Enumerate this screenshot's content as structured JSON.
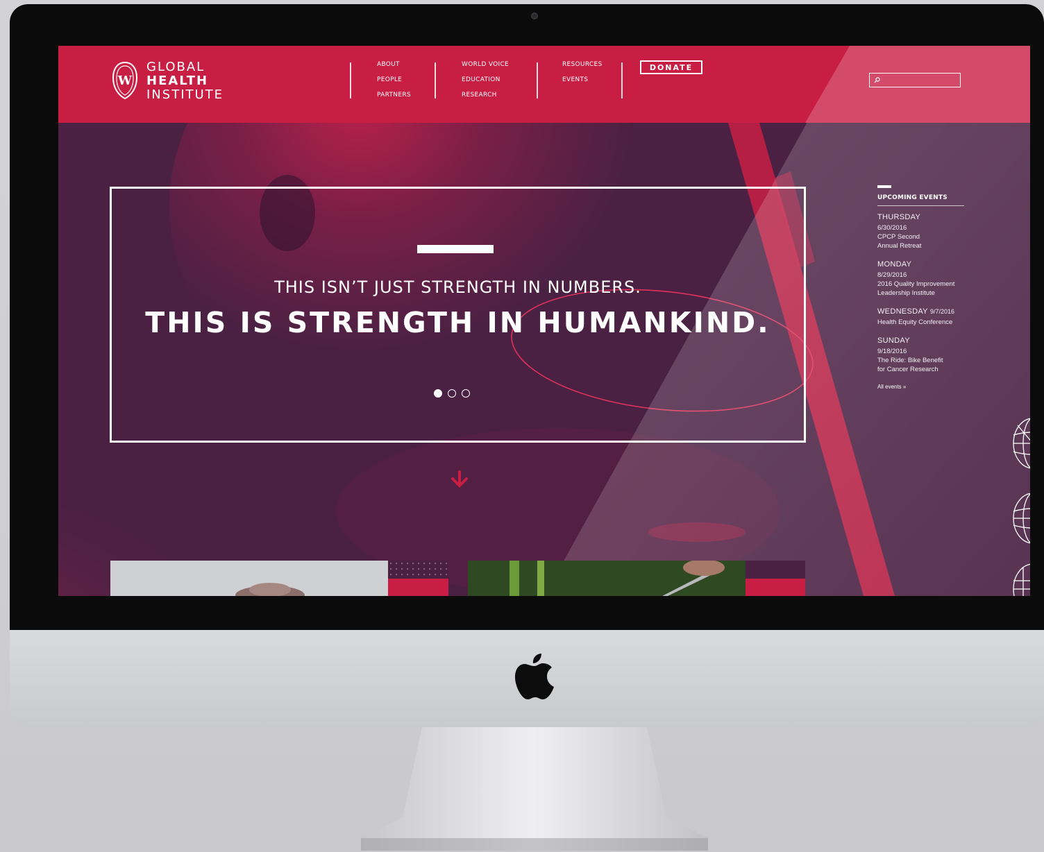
{
  "colors": {
    "brand_red": "#c91e44",
    "hero_purple": "#4a2143",
    "text_white": "#ffffff"
  },
  "site": {
    "logo_lines": [
      "GLOBAL",
      "HEALTH",
      "INSTITUTE"
    ],
    "crest_letter": "W"
  },
  "nav": {
    "col1": [
      "ABOUT",
      "PEOPLE",
      "PARTNERS"
    ],
    "col2": [
      "WORLD VOICE",
      "EDUCATION",
      "RESEARCH"
    ],
    "col3": [
      "RESOURCES",
      "EVENTS"
    ],
    "donate_label": "DONATE"
  },
  "search": {
    "icon": "search-icon",
    "value": ""
  },
  "hero": {
    "line1": "THIS ISN’T JUST STRENGTH IN NUMBERS.",
    "line2": "THIS IS STRENGTH IN HUMANKIND.",
    "slide_count": 3,
    "active_slide": 1,
    "scroll_icon": "arrow-down-icon"
  },
  "events": {
    "heading": "UPCOMING EVENTS",
    "items": [
      {
        "day": "THURSDAY",
        "date": "6/30/2016",
        "title_lines": [
          "CPCP Second",
          "Annual Retreat"
        ]
      },
      {
        "day": "MONDAY",
        "date": "8/29/2016",
        "title_lines": [
          "2016 Quality Improvement",
          "Leadership Institute"
        ]
      },
      {
        "day": "WEDNESDAY",
        "date": "9/7/2016",
        "title_lines": [
          "Health Equity Conference"
        ]
      },
      {
        "day": "SUNDAY",
        "date": "9/18/2016",
        "title_lines": [
          "The Ride: Bike Benefit",
          "for Cancer Research"
        ]
      }
    ],
    "all_events_label": "All events »"
  }
}
